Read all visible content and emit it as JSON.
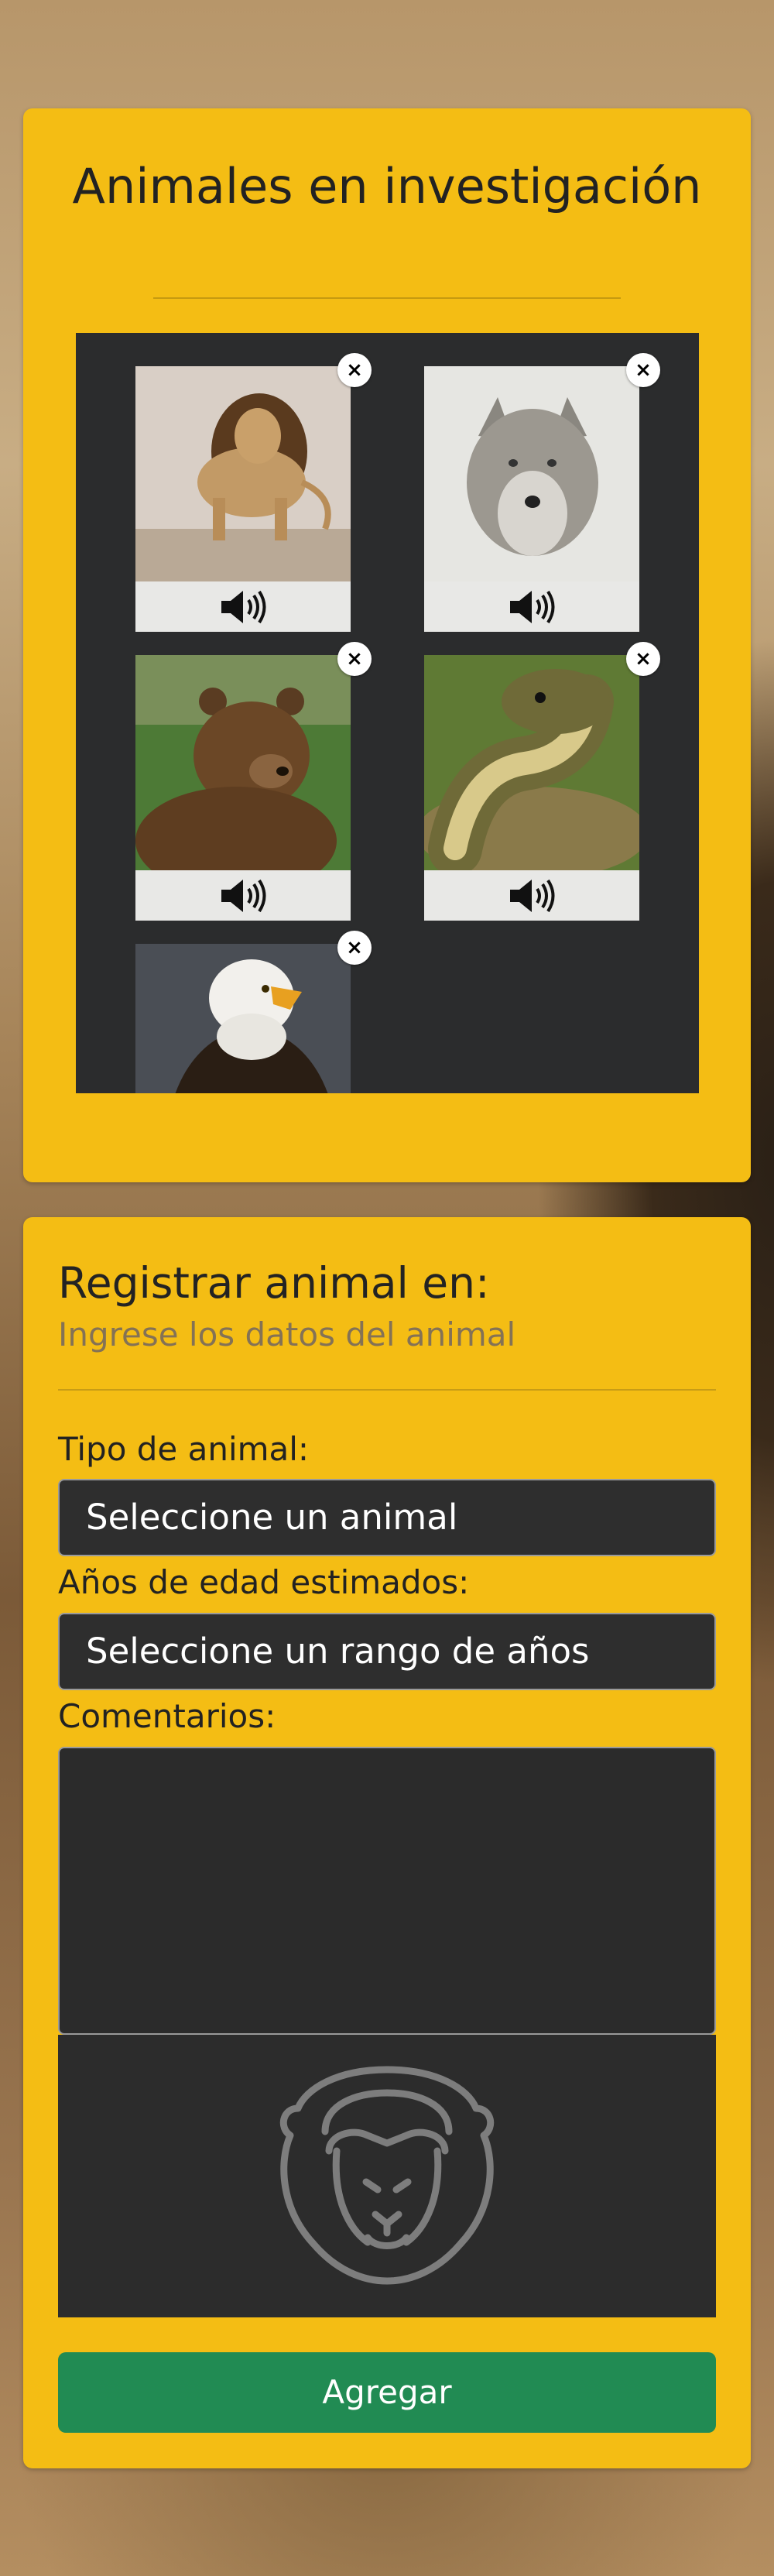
{
  "gallery": {
    "title": "Animales en investigación",
    "items": [
      {
        "name": "lion",
        "remove": "×"
      },
      {
        "name": "wolf",
        "remove": "×"
      },
      {
        "name": "bear",
        "remove": "×"
      },
      {
        "name": "snake",
        "remove": "×"
      },
      {
        "name": "eagle",
        "remove": "×"
      }
    ]
  },
  "form": {
    "heading": "Registrar animal en:",
    "subheading": "Ingrese los datos del animal",
    "animal_label": "Tipo de animal:",
    "animal_select": "Seleccione un animal",
    "age_label": "Años de edad estimados:",
    "age_select": "Seleccione un rango de años",
    "comments_label": "Comentarios:",
    "comments_value": "",
    "preview_icon": "lion-outline-icon",
    "submit_label": "Agregar"
  },
  "colors": {
    "card": "#f4bd14",
    "gallery_bg": "#2b2c2d",
    "submit": "#218b53"
  }
}
